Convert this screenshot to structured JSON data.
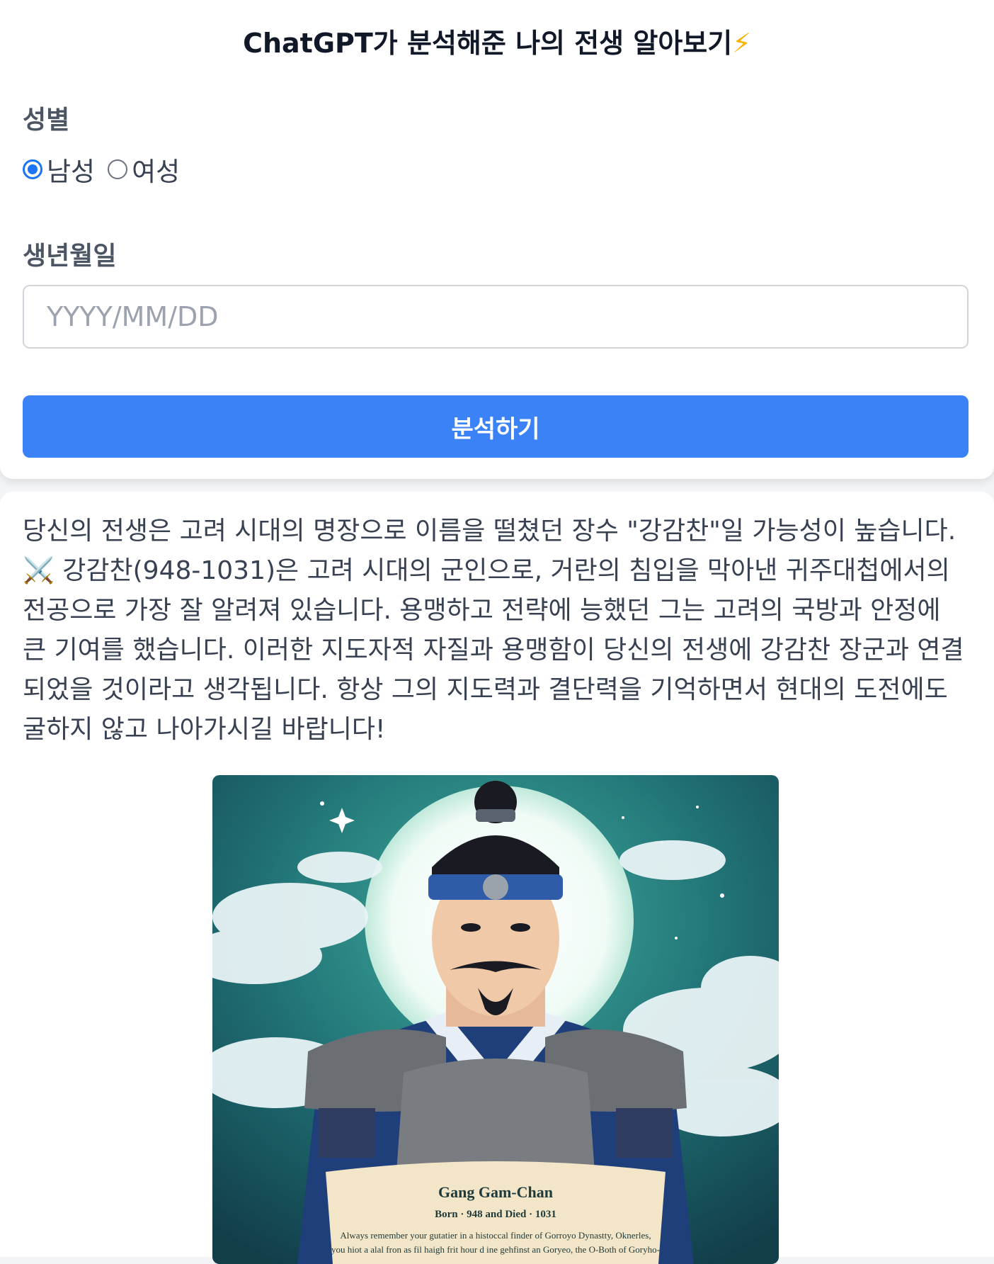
{
  "header": {
    "title": "ChatGPT가 분석해준 나의 전생 알아보기",
    "title_emoji": "⚡"
  },
  "gender": {
    "label": "성별",
    "options": [
      {
        "label": "남성",
        "checked": true
      },
      {
        "label": "여성",
        "checked": false
      }
    ]
  },
  "birthdate": {
    "label": "생년월일",
    "placeholder": "YYYY/MM/DD",
    "value": ""
  },
  "submit_label": "분석하기",
  "result": {
    "text": "당신의 전생은 고려 시대의 명장으로 이름을 떨쳤던 장수 \"강감찬\"일 가능성이 높습니다. ⚔️ 강감찬(948-1031)은 고려 시대의 군인으로, 거란의 침입을 막아낸 귀주대첩에서의 전공으로 가장 잘 알려져 있습니다. 용맹하고 전략에 능했던 그는 고려의 국방과 안정에 큰 기여를 했습니다. 이러한 지도자적 자질과 용맹함이 당신의 전생에 강감찬 장군과 연결되었을 것이라고 생각됩니다. 항상 그의 지도력과 결단력을 기억하면서 현대의 도전에도 굴하지 않고 나아가시길 바랍니다!",
    "image": {
      "scroll_title": "Gang Gam-Chan",
      "scroll_subtitle": "Born · 948 and Died · 1031",
      "scroll_line1": "Always remember your gutatier in a histoccal finder of Gorroyo Dynastty, Oknerles,",
      "scroll_line2": "you hiot a alal fron as fil haigh frit hour d ine gehfinst an Goryeo, the O-Both of Goryho-"
    }
  }
}
